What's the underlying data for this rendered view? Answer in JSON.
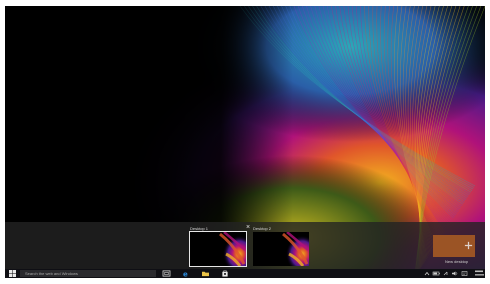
{
  "task_view": {
    "desktops": [
      {
        "label": "Desktop 1",
        "active": true
      },
      {
        "label": "Desktop 2",
        "active": false
      }
    ],
    "close_glyph": "×",
    "new_desktop_label": "New desktop"
  },
  "taskbar": {
    "search_placeholder": "Search the web and Windows",
    "pinned_icons": [
      "task-view-icon",
      "edge-icon",
      "file-explorer-icon",
      "store-icon"
    ],
    "tray_icons": [
      "chevron-up-icon",
      "battery-icon",
      "network-icon",
      "volume-icon",
      "action-center-icon"
    ]
  },
  "colors": {
    "taskbar": "#0f0f14",
    "task_view_strip": "#232323",
    "new_desktop_tile": "#a65a24"
  }
}
